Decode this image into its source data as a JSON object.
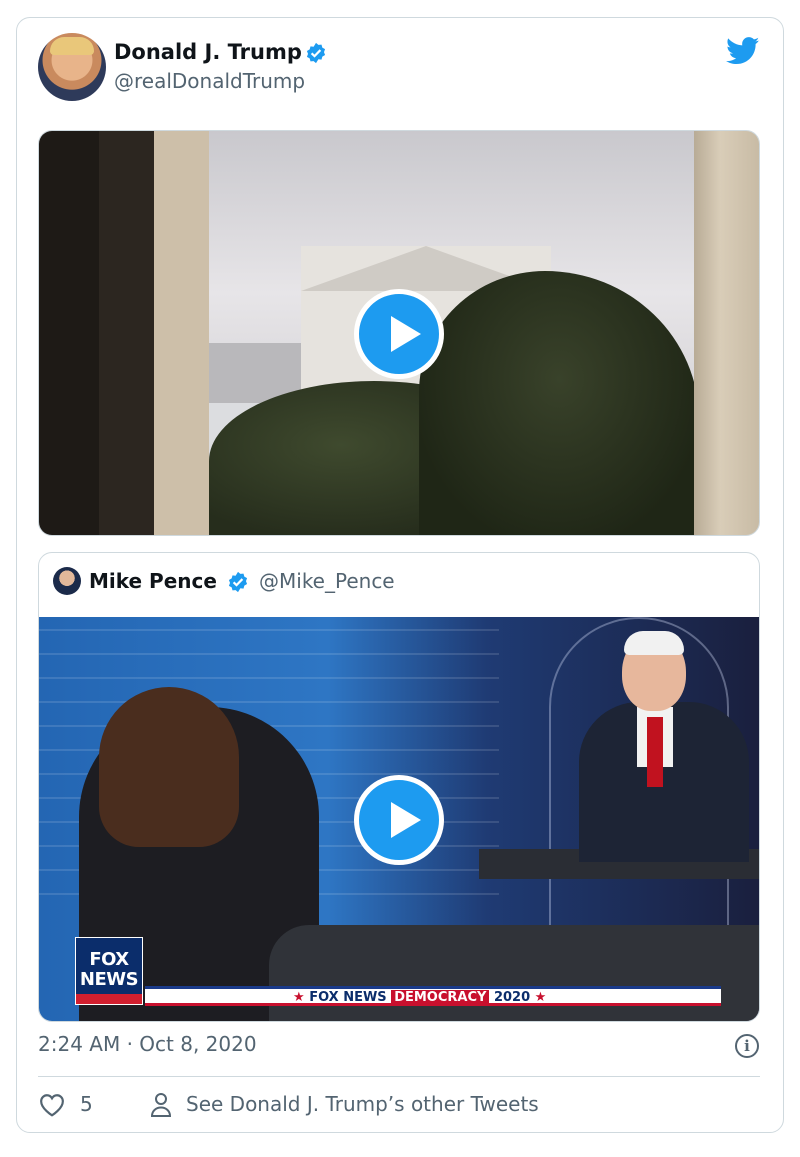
{
  "tweet": {
    "author_name": "Donald J. Trump",
    "author_handle": "@realDonaldTrump",
    "timestamp": "2:24 AM · Oct 8, 2020",
    "like_count": "5",
    "see_other_label": "See Donald J. Trump’s other Tweets"
  },
  "quoted_tweet": {
    "author_name": "Mike Pence",
    "author_handle": "@Mike_Pence",
    "overlay": {
      "logo_line1": "FOX",
      "logo_line2": "NEWS",
      "banner_brand": "FOX NEWS",
      "banner_democracy": "DEMOCRACY",
      "banner_year": "2020"
    }
  },
  "icons": {
    "verified": "verified-badge-icon",
    "brand": "twitter-bird-icon",
    "play": "play-icon",
    "info": "info-icon",
    "like": "heart-icon",
    "profile": "person-icon"
  },
  "colors": {
    "accent": "#1d9bf0",
    "text_primary": "#0f1419",
    "text_secondary": "#536471",
    "border": "#cfd9de"
  }
}
